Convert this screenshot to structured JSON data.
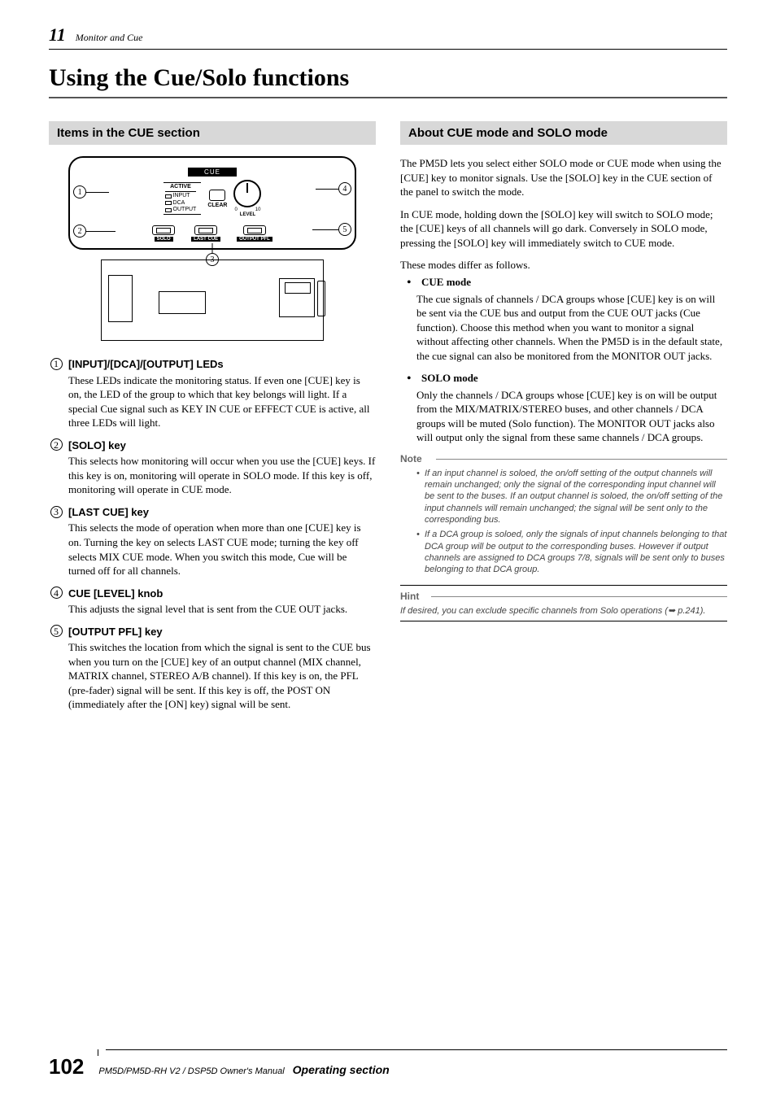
{
  "header": {
    "chapter_num": "11",
    "chapter_title": "Monitor and Cue"
  },
  "main_title": "Using the Cue/Solo functions",
  "left": {
    "section_title": "Items in the CUE section",
    "diagram": {
      "title_bar": "CUE",
      "active_label": "ACTIVE",
      "led_labels": [
        "INPUT",
        "DCA",
        "OUTPUT"
      ],
      "clear_label": "CLEAR",
      "knob_scale": [
        "0",
        "10"
      ],
      "knob_label": "LEVEL",
      "buttons": [
        "SOLO",
        "LAST CUE",
        "OUTPUT PFL"
      ],
      "callouts": [
        "1",
        "2",
        "3",
        "4",
        "5"
      ]
    },
    "items": [
      {
        "num": "1",
        "title": "[INPUT]/[DCA]/[OUTPUT] LEDs",
        "body": "These LEDs indicate the monitoring status. If even one [CUE] key is on, the LED of the group to which that key belongs will light. If a special Cue signal such as KEY IN CUE or EFFECT CUE is active, all three LEDs will light."
      },
      {
        "num": "2",
        "title": "[SOLO] key",
        "body": "This selects how monitoring will occur when you use the [CUE] keys. If this key is on, monitoring will operate in SOLO mode. If this key is off, monitoring will operate in CUE mode."
      },
      {
        "num": "3",
        "title": "[LAST CUE] key",
        "body": "This selects the mode of operation when more than one [CUE] key is on. Turning the key on selects LAST CUE mode; turning the key off selects MIX CUE mode. When you switch this mode, Cue will be turned off for all channels."
      },
      {
        "num": "4",
        "title": "CUE [LEVEL] knob",
        "body": "This adjusts the signal level that is sent from the CUE OUT jacks."
      },
      {
        "num": "5",
        "title": "[OUTPUT PFL] key",
        "body": "This switches the location from which the signal is sent to the CUE bus when you turn on the [CUE] key of an output channel (MIX channel, MATRIX channel, STEREO A/B channel). If this key is on, the PFL (pre-fader) signal will be sent. If this key is off, the POST ON (immediately after the [ON] key) signal will be sent."
      }
    ]
  },
  "right": {
    "section_title": "About CUE mode and SOLO mode",
    "para1": "The PM5D lets you select either SOLO mode or CUE mode when using the [CUE] key to monitor signals. Use the [SOLO] key in the CUE section of the panel to switch the mode.",
    "para2": "In CUE mode, holding down the [SOLO] key will switch to SOLO mode; the [CUE] keys of all channels will go dark. Conversely in SOLO mode, pressing the [SOLO] key will immediately switch to CUE mode.",
    "para3": "These modes differ as follows.",
    "modes": [
      {
        "title": "CUE mode",
        "body": "The cue signals of channels / DCA groups whose [CUE] key is on will be sent via the CUE bus and output from the CUE OUT jacks (Cue function). Choose this method when you want to monitor a signal without affecting other channels. When the PM5D is in the default state, the cue signal can also be monitored from the MONITOR OUT jacks."
      },
      {
        "title": "SOLO mode",
        "body": "Only the channels / DCA groups whose [CUE] key is on will be output from the MIX/MATRIX/STEREO buses, and other channels / DCA groups will be muted (Solo function). The MONITOR OUT jacks also will output only the signal from these same channels / DCA groups."
      }
    ],
    "note_label": "Note",
    "notes": [
      "If an input channel is soloed, the on/off setting of the output channels will remain unchanged; only the signal of the corresponding input channel will be sent to the buses. If an output channel is soloed, the on/off setting of the input channels will remain unchanged; the signal will be sent only to the corresponding bus.",
      "If a DCA group is soloed, only the signals of input channels belonging to that DCA group will be output to the corresponding buses. However if output channels are assigned to DCA groups 7/8, signals will be sent only to buses belonging to that DCA group."
    ],
    "hint_label": "Hint",
    "hint_body": "If desired, you can exclude specific channels from Solo operations (➥ p.241)."
  },
  "footer": {
    "page": "102",
    "doc": "PM5D/PM5D-RH V2 / DSP5D Owner's Manual",
    "section": "Operating section"
  }
}
